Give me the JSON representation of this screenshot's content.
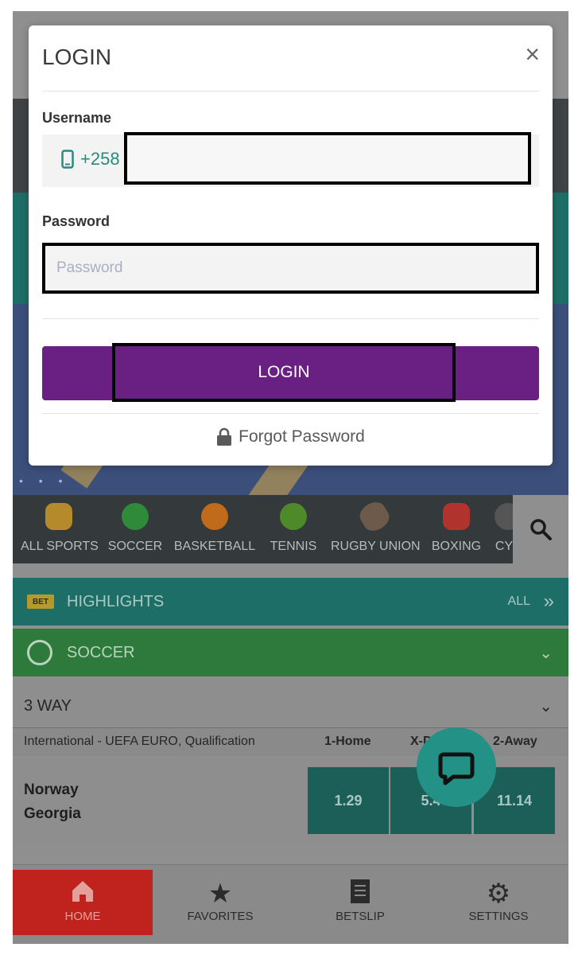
{
  "login_modal": {
    "title": "LOGIN",
    "close_symbol": "×",
    "username_label": "Username",
    "phone_prefix": "+258",
    "username_value": "",
    "password_label": "Password",
    "password_placeholder": "Password",
    "login_button_label": "LOGIN",
    "forgot_password_label": "Forgot Password",
    "accent_color": "#6a1f82",
    "icons": [
      "phone-icon",
      "close-icon",
      "lock-icon"
    ]
  },
  "sports_bar": {
    "items": [
      {
        "label": "ALL SPORTS",
        "icon": "all-sports-icon"
      },
      {
        "label": "SOCCER",
        "icon": "soccer-ball-icon"
      },
      {
        "label": "BASKETBALL",
        "icon": "basketball-icon"
      },
      {
        "label": "TENNIS",
        "icon": "tennis-ball-icon"
      },
      {
        "label": "RUGBY UNION",
        "icon": "rugby-ball-icon"
      },
      {
        "label": "BOXING",
        "icon": "boxing-glove-icon"
      },
      {
        "label": "CY",
        "icon": "cycling-icon"
      }
    ],
    "search_icon": "search-icon"
  },
  "highlights": {
    "badge": "BET",
    "label": "HIGHLIGHTS",
    "all_label": "ALL"
  },
  "soccer_section": {
    "label": "SOCCER"
  },
  "market_selector": {
    "value": "3 WAY"
  },
  "match_table": {
    "competition": "International - UEFA EURO, Qualification",
    "columns": [
      "1-Home",
      "X-D",
      "2-Away"
    ],
    "rows": [
      {
        "home": "Norway",
        "away": "Georgia",
        "odds": [
          "1.29",
          "5.4",
          "11.14"
        ]
      }
    ]
  },
  "bottom_nav": {
    "items": [
      {
        "label": "HOME",
        "icon": "home-icon",
        "active": true
      },
      {
        "label": "FAVORITES",
        "icon": "star-icon",
        "active": false
      },
      {
        "label": "BETSLIP",
        "icon": "betslip-icon",
        "active": false
      },
      {
        "label": "SETTINGS",
        "icon": "gear-icon",
        "active": false
      }
    ]
  }
}
